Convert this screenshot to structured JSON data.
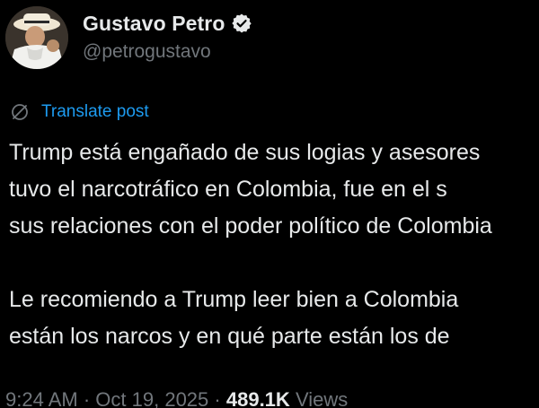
{
  "author": {
    "display_name": "Gustavo Petro",
    "handle": "@petrogustavo"
  },
  "translate": {
    "label": "Translate post"
  },
  "post": {
    "lines": [
      "Trump está engañado de sus logias y asesores",
      "tuvo el narcotráfico en Colombia, fue en el s",
      "sus relaciones con el poder político de Colombia",
      "",
      "Le recomiendo a Trump leer bien a Colombia",
      "están los narcos y en qué parte están los de"
    ]
  },
  "meta": {
    "time": "9:24 AM",
    "separator_1": "·",
    "date": "Oct 19, 2025",
    "separator_2": "·",
    "views_count": "489.1K",
    "views_label": "Views"
  },
  "colors": {
    "background": "#000000",
    "text_primary": "#e7e9ea",
    "text_secondary": "#71767b",
    "accent": "#1d9bf0",
    "verified_badge": "#e7e9ea"
  },
  "icons": {
    "verified": "verified-badge-icon",
    "translate": "translate-globe-icon"
  }
}
